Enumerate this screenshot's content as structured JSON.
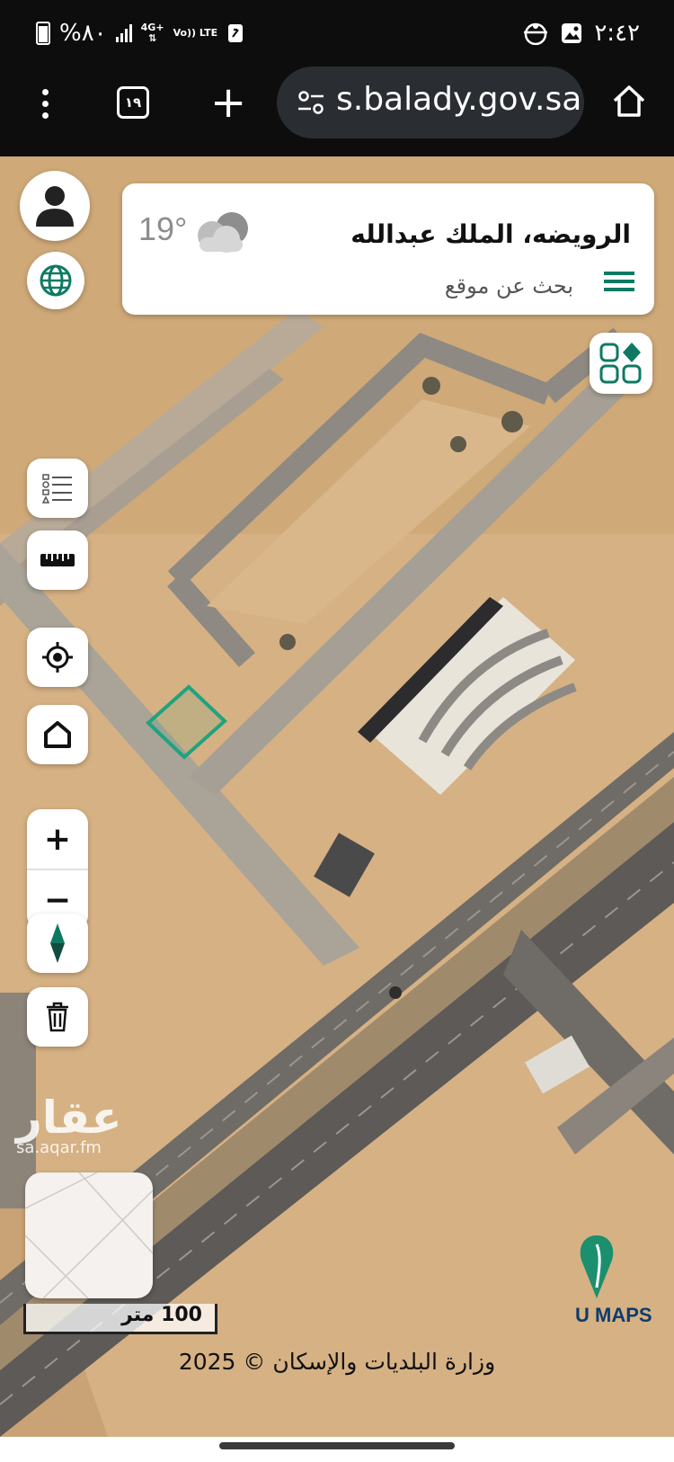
{
  "status_bar": {
    "battery": "%٨٠",
    "network_type": "4G+",
    "volte": "Vo)) LTE",
    "time": "٢:٤٢"
  },
  "browser": {
    "tab_count": "١٩",
    "url": "s.balady.gov.sa"
  },
  "search_card": {
    "location_name": "الرويضه، الملك عبدالله",
    "search_placeholder": "بحث عن موقع",
    "temperature": "19°"
  },
  "map": {
    "watermark_logo": "عقار",
    "watermark_url": "sa.aqar.fm",
    "scale_label": "100 متر",
    "provider": "U MAPS",
    "copyright": "وزارة البلديات والإسكان © 2025",
    "accent_color": "#0f7a63",
    "parcel_color": "#1fa37e"
  }
}
